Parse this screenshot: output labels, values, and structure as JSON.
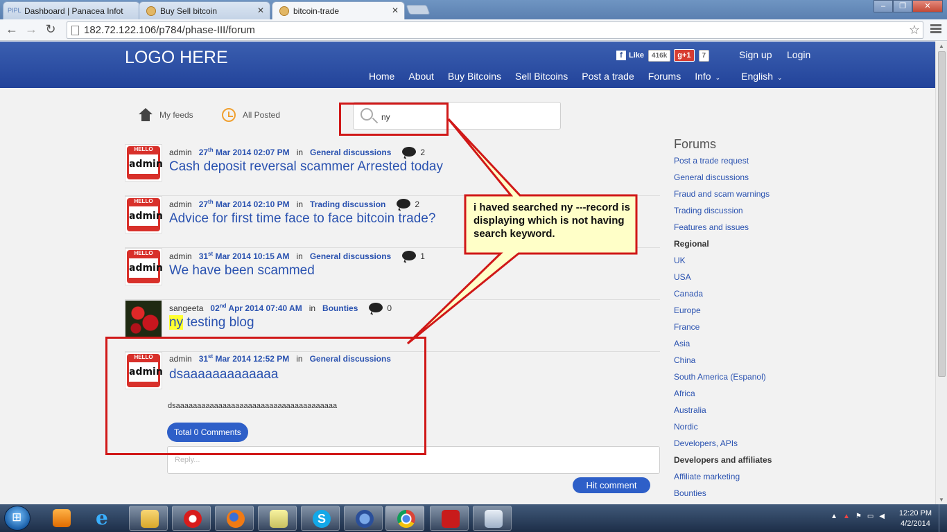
{
  "browser": {
    "tabs": [
      {
        "icon": "pipl",
        "title": "Dashboard | Panacea Infot"
      },
      {
        "icon": "bitcoin",
        "title": "Buy Sell bitcoin"
      },
      {
        "icon": "bitcoin",
        "title": "bitcoin-trade"
      }
    ],
    "url": "182.72.122.106/p784/phase-III/forum"
  },
  "site": {
    "logo": "LOGO HERE",
    "fb_like": "Like",
    "fb_count": "416k",
    "gplus": "g+1",
    "gplus_count": "7",
    "signup": "Sign up",
    "login": "Login",
    "nav": [
      "Home",
      "About",
      "Buy Bitcoins",
      "Sell Bitcoins",
      "Post a trade",
      "Forums",
      "Info",
      "English"
    ]
  },
  "feed": {
    "my_feeds": "My feeds",
    "all_posted": "All Posted",
    "search_value": "ny"
  },
  "posts": [
    {
      "author": "admin",
      "day": "27",
      "suffix": "th",
      "date_rest": "Mar 2014 02:07 PM",
      "in": "in",
      "category": "General discussions",
      "comments": "2",
      "title": "Cash deposit reversal scammer Arrested today"
    },
    {
      "author": "admin",
      "day": "27",
      "suffix": "th",
      "date_rest": "Mar 2014 02:10 PM",
      "in": "in",
      "category": "Trading discussion",
      "comments": "2",
      "title": "Advice for first time face to face bitcoin trade?"
    },
    {
      "author": "admin",
      "day": "31",
      "suffix": "st",
      "date_rest": "Mar 2014 10:15 AM",
      "in": "in",
      "category": "General discussions",
      "comments": "1",
      "title": "We have been scammed"
    },
    {
      "author": "sangeeta",
      "day": "02",
      "suffix": "nd",
      "date_rest": "Apr 2014 07:40 AM",
      "in": "in",
      "category": "Bounties",
      "comments": "0",
      "title_highlight": "ny",
      "title_rest": " testing blog"
    },
    {
      "author": "admin",
      "day": "31",
      "suffix": "st",
      "date_rest": "Mar 2014 12:52 PM",
      "in": "in",
      "category": "General discussions",
      "title": "dsaaaaaaaaaaaaa",
      "excerpt": "dsaaaaaaaaaaaaaaaaaaaaaaaaaaaaaaaaaaaaaa",
      "total_comments": "Total 0 Comments"
    }
  ],
  "reply_placeholder": "Reply...",
  "hit_comment": "Hit comment",
  "sidebar": {
    "title": "Forums",
    "items": [
      {
        "label": "Post a trade request",
        "bold": false
      },
      {
        "label": "General discussions",
        "bold": false
      },
      {
        "label": "Fraud and scam warnings",
        "bold": false
      },
      {
        "label": "Trading discussion",
        "bold": false
      },
      {
        "label": "Features and issues",
        "bold": false
      },
      {
        "label": "Regional",
        "bold": true
      },
      {
        "label": "UK",
        "bold": false
      },
      {
        "label": "USA",
        "bold": false
      },
      {
        "label": "Canada",
        "bold": false
      },
      {
        "label": "Europe",
        "bold": false
      },
      {
        "label": "France",
        "bold": false
      },
      {
        "label": "Asia",
        "bold": false
      },
      {
        "label": "China",
        "bold": false
      },
      {
        "label": "South America (Espanol)",
        "bold": false
      },
      {
        "label": "Africa",
        "bold": false
      },
      {
        "label": "Australia",
        "bold": false
      },
      {
        "label": "Nordic",
        "bold": false
      },
      {
        "label": "Developers, APIs",
        "bold": false
      },
      {
        "label": "Developers and affiliates",
        "bold": true
      },
      {
        "label": "Affiliate marketing",
        "bold": false
      },
      {
        "label": "Bounties",
        "bold": false
      }
    ]
  },
  "annotation": {
    "text": "i haved searched ny ---record is displaying which is not having search keyword."
  },
  "avatar_text": {
    "hello": "HELLO",
    "name": "admin"
  },
  "taskbar": {
    "time": "12:20 PM",
    "date": "4/2/2014"
  },
  "colors": {
    "header": "#2c4ea3",
    "link": "#2a52b0",
    "annotation_red": "#d01818",
    "callout_fill": "#ffffc8"
  }
}
